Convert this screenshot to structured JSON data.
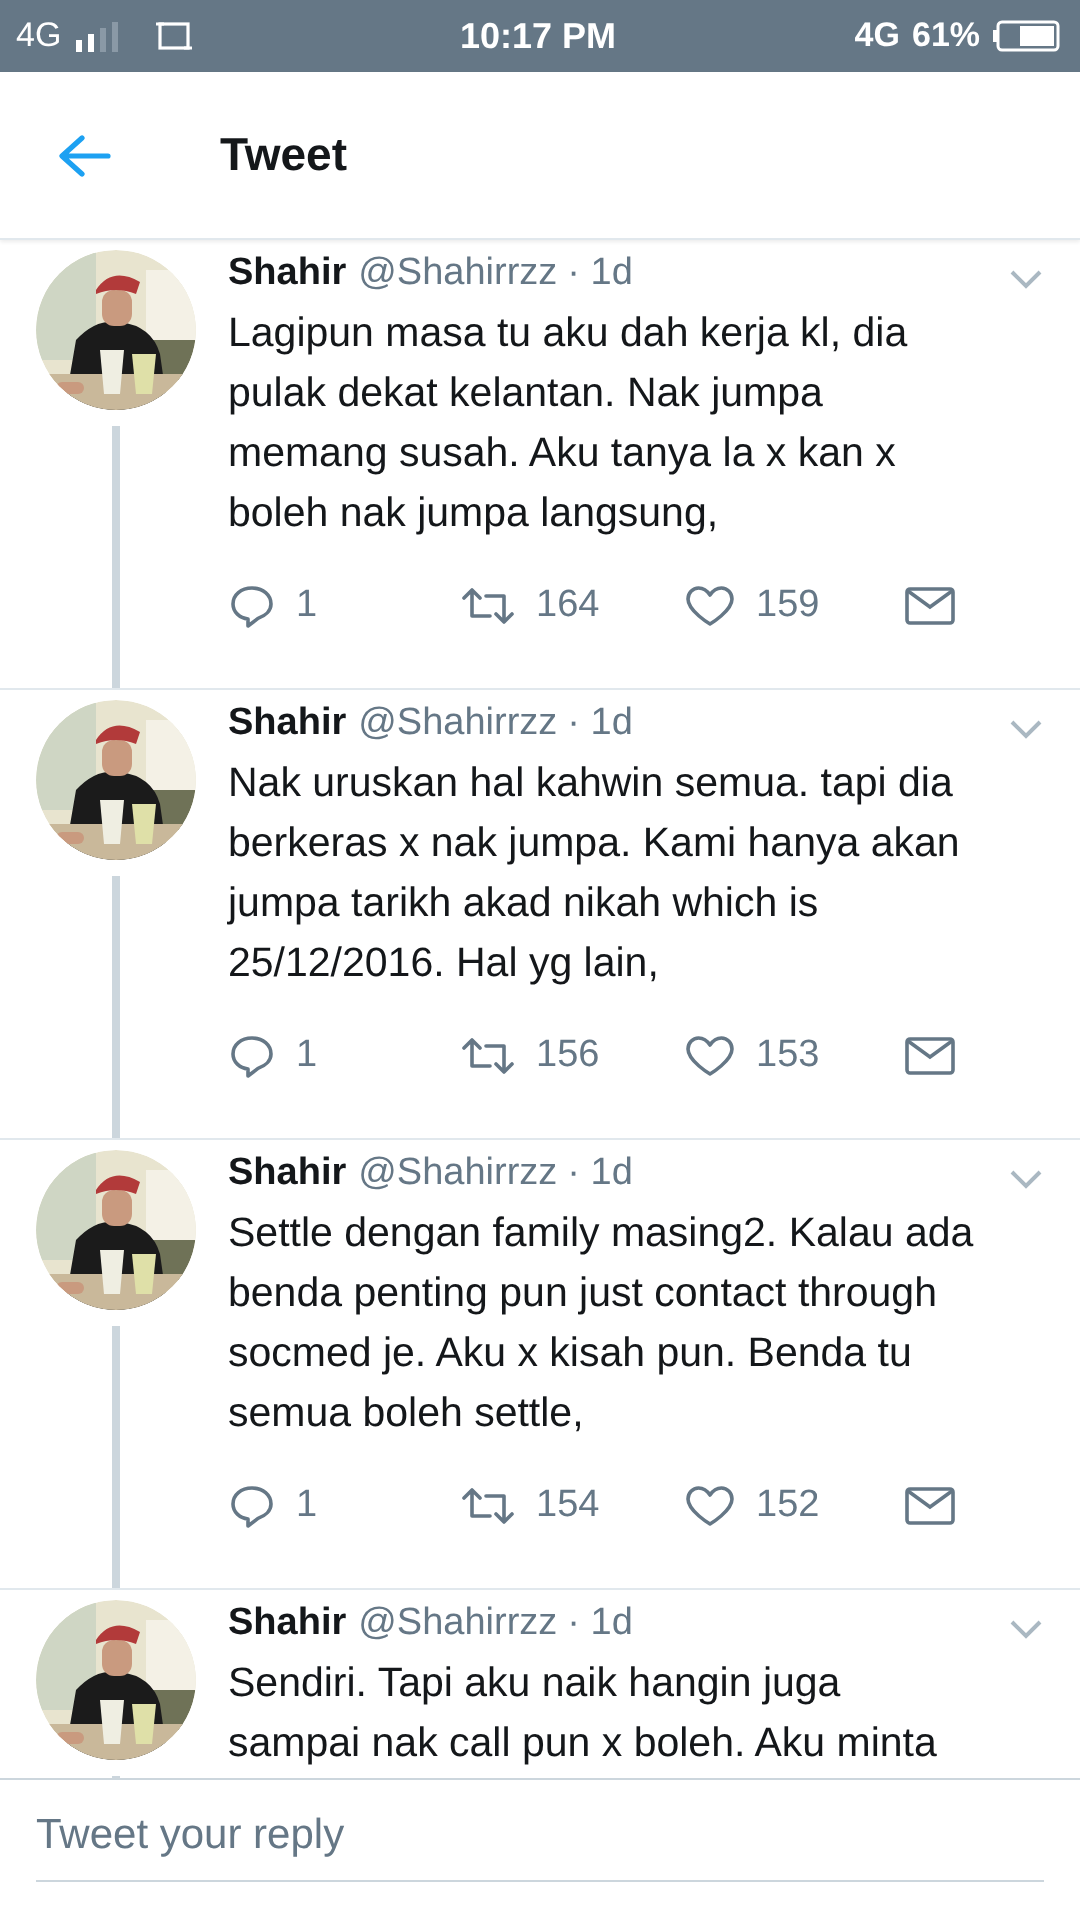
{
  "status_bar": {
    "network_left": "4G",
    "time": "10:17 PM",
    "network_right": "4G",
    "battery": "61%"
  },
  "header": {
    "title": "Tweet"
  },
  "tweets": [
    {
      "name": "Shahir",
      "handle": "@Shahirrzz",
      "time": "· 1d",
      "lines": [
        "Lagipun masa tu aku dah kerja kl, dia",
        "pulak dekat kelantan. Nak jumpa",
        "memang susah. Aku tanya la x kan x",
        "boleh nak jumpa langsung,"
      ],
      "actions": {
        "replies": "1",
        "retweets": "164",
        "likes": "159"
      }
    },
    {
      "name": "Shahir",
      "handle": "@Shahirrzz",
      "time": "· 1d",
      "lines": [
        "Nak uruskan hal kahwin semua. tapi dia",
        "berkeras x nak jumpa. Kami hanya akan",
        "jumpa tarikh akad nikah which is",
        "25/12/2016. Hal yg lain,"
      ],
      "actions": {
        "replies": "1",
        "retweets": "156",
        "likes": "153"
      }
    },
    {
      "name": "Shahir",
      "handle": "@Shahirrzz",
      "time": "· 1d",
      "lines": [
        "Settle dengan family masing2. Kalau ada",
        "benda penting pun just contact through",
        "socmed je. Aku x kisah pun. Benda tu",
        "semua boleh settle,"
      ],
      "actions": {
        "replies": "1",
        "retweets": "154",
        "likes": "152"
      }
    },
    {
      "name": "Shahir",
      "handle": "@Shahirrzz",
      "time": "· 1d",
      "lines": [
        "Sendiri. Tapi aku naik hangin juga",
        "sampai nak call pun x boleh. Aku minta"
      ]
    }
  ],
  "reply_bar": {
    "placeholder": "Tweet your reply"
  }
}
